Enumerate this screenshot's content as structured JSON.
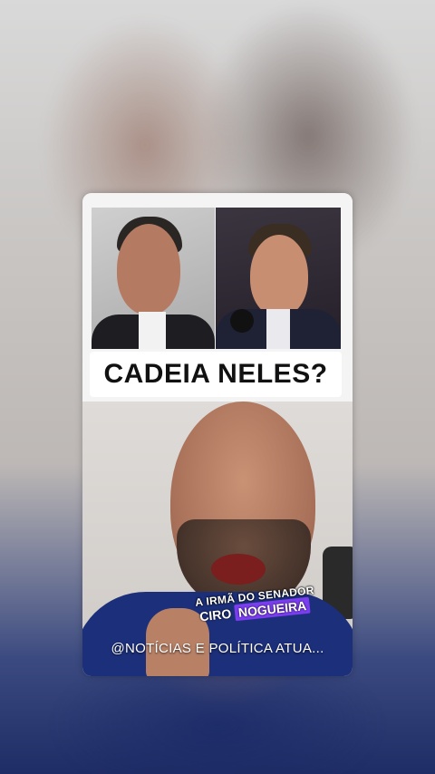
{
  "headline": "CADEIA NELES?",
  "caption": {
    "line1": "A IRMÃ DO SENADOR",
    "line2_plain": "CIRO",
    "line2_highlight": "NOGUEIRA"
  },
  "handle": "@NOTÍCIAS E POLÍTICA ATUA...",
  "colors": {
    "headline_bg": "#ffffff",
    "highlight": "#7b3df0"
  }
}
